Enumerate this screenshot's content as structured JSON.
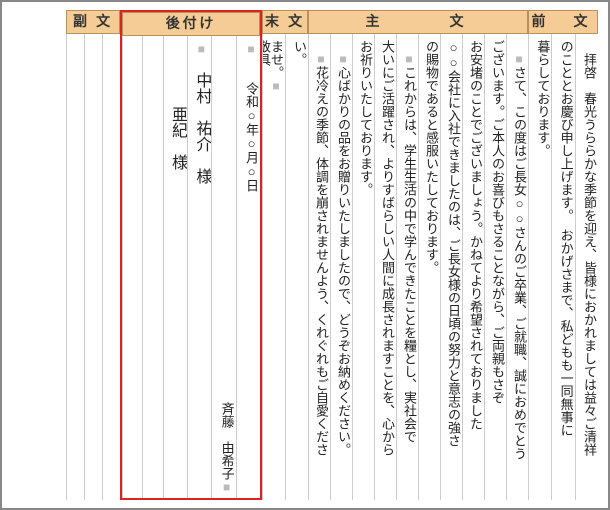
{
  "headers": {
    "prelude": "前　文",
    "main": "主　　　文",
    "closing": "末 文",
    "postscript": "後付け",
    "subtext": "副 文"
  },
  "columns": {
    "c1": "　拝啓　春光うららかな季節を迎え、皆様におかれましては益々ご清祥",
    "c2": "のこととお慶び申し上げます。　おかげさまで、私どもも一同無事に",
    "c3": "暮らしております。",
    "c4_pre": "　",
    "c4": "さて、この度はご長女○○さんのご卒業、ご就職、誠におめでとう",
    "c5": "ございます。ご本人のお喜びもさることながら、ご両親もさぞ",
    "c6": "お安堵のことでございましょう。かねてより希望されておりました",
    "c7": "○○会社に入社できましたのは、ご長女様の日頃の努力と意志の強さ",
    "c8": "の賜物であると感服いたしております。",
    "c9_pre": "　",
    "c9": "これからは、学生生活の中で学んできたことを糧とし、実社会で",
    "c10": "大いにご活躍され、よりすばらしい人間に成長されますことを、心から",
    "c11": "お祈りいたしております。",
    "c12_pre": "　",
    "c12": "心ばかりの品をお贈りいたしましたので、どうぞお納めください。",
    "c13_pre": "　",
    "c13": "花冷えの季節、体調を崩されませんよう、くれぐれもご自愛くださ",
    "c14a": "い。",
    "c14b": "ませ。",
    "c15": "敬具",
    "c16": "　　令和○年○月○日",
    "c17": "斉藤　由希子",
    "c18": "　中村　祐介　様",
    "c19": "　　　　亜紀　様"
  }
}
